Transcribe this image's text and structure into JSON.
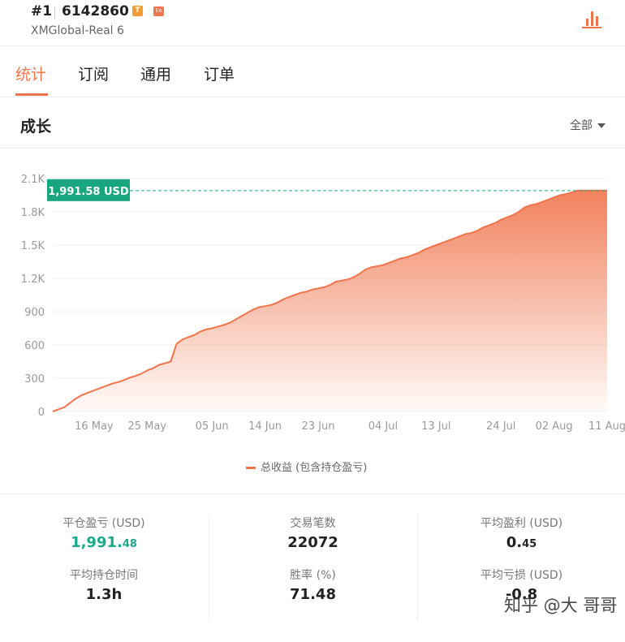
{
  "header": {
    "rank": "#1",
    "account": "6142860",
    "badge_t": "T",
    "badge_ea": "EA",
    "server": "XMGlobal-Real 6"
  },
  "tabs": [
    {
      "label": "统计",
      "active": true
    },
    {
      "label": "订阅",
      "active": false
    },
    {
      "label": "通用",
      "active": false
    },
    {
      "label": "订单",
      "active": false
    }
  ],
  "section": {
    "title": "成长",
    "range": "全部"
  },
  "chart_data": {
    "type": "area",
    "y_ticks": [
      "0",
      "300",
      "600",
      "900",
      "1.2K",
      "1.5K",
      "1.8K",
      "2.1K"
    ],
    "ylim": [
      0,
      2100
    ],
    "x_ticks": [
      "16 May",
      "25 May",
      "05 Jun",
      "14 Jun",
      "23 Jun",
      "04 Jul",
      "13 Jul",
      "24 Jul",
      "02 Aug",
      "11 Aug"
    ],
    "current_label": "1,991.58 USD",
    "current_value": 1991.58,
    "series": [
      {
        "name": "总收益 (包含持仓盈亏)",
        "color": "#f0744b",
        "x": [
          "09 May",
          "10 May",
          "11 May",
          "12 May",
          "13 May",
          "14 May",
          "15 May",
          "16 May",
          "17 May",
          "18 May",
          "19 May",
          "20 May",
          "21 May",
          "22 May",
          "23 May",
          "24 May",
          "25 May",
          "26 May",
          "27 May",
          "28 May",
          "29 May",
          "30 May",
          "31 May",
          "01 Jun",
          "02 Jun",
          "03 Jun",
          "04 Jun",
          "05 Jun",
          "06 Jun",
          "07 Jun",
          "08 Jun",
          "09 Jun",
          "10 Jun",
          "11 Jun",
          "12 Jun",
          "13 Jun",
          "14 Jun",
          "15 Jun",
          "16 Jun",
          "17 Jun",
          "18 Jun",
          "19 Jun",
          "20 Jun",
          "21 Jun",
          "22 Jun",
          "23 Jun",
          "24 Jun",
          "25 Jun",
          "26 Jun",
          "27 Jun",
          "28 Jun",
          "29 Jun",
          "30 Jun",
          "01 Jul",
          "02 Jul",
          "03 Jul",
          "04 Jul",
          "05 Jul",
          "06 Jul",
          "07 Jul",
          "08 Jul",
          "09 Jul",
          "10 Jul",
          "11 Jul",
          "12 Jul",
          "13 Jul",
          "14 Jul",
          "15 Jul",
          "16 Jul",
          "17 Jul",
          "18 Jul",
          "19 Jul",
          "20 Jul",
          "21 Jul",
          "22 Jul",
          "23 Jul",
          "24 Jul",
          "25 Jul",
          "26 Jul",
          "27 Jul",
          "28 Jul",
          "29 Jul",
          "30 Jul",
          "31 Jul",
          "01 Aug",
          "02 Aug",
          "03 Aug",
          "04 Aug",
          "05 Aug",
          "06 Aug",
          "07 Aug",
          "08 Aug",
          "09 Aug",
          "10 Aug",
          "11 Aug"
        ],
        "values": [
          0,
          20,
          40,
          80,
          120,
          150,
          170,
          190,
          210,
          230,
          250,
          265,
          280,
          305,
          320,
          340,
          370,
          390,
          420,
          435,
          450,
          610,
          650,
          670,
          690,
          720,
          740,
          750,
          765,
          780,
          800,
          830,
          860,
          890,
          920,
          940,
          950,
          960,
          980,
          1010,
          1030,
          1050,
          1070,
          1080,
          1100,
          1110,
          1120,
          1140,
          1170,
          1180,
          1190,
          1210,
          1240,
          1280,
          1300,
          1310,
          1320,
          1340,
          1360,
          1380,
          1390,
          1410,
          1430,
          1460,
          1480,
          1500,
          1520,
          1540,
          1560,
          1580,
          1600,
          1610,
          1630,
          1660,
          1680,
          1700,
          1730,
          1750,
          1770,
          1800,
          1840,
          1860,
          1870,
          1890,
          1910,
          1930,
          1950,
          1960,
          1975,
          1991.58,
          1991.58,
          1991.58,
          1991.58,
          1991.58,
          1991.58
        ]
      }
    ],
    "grid": true
  },
  "stats": {
    "closed_pl_label": "平仓盈亏 (USD)",
    "closed_pl_main": "1,991.",
    "closed_pl_cents": "48",
    "trades_label": "交易笔数",
    "trades_value": "22072",
    "avg_profit_label": "平均盈利 (USD)",
    "avg_profit_main": "0.",
    "avg_profit_cents": "45",
    "avg_hold_label": "平均持仓时间",
    "avg_hold_value": "1.3h",
    "winrate_label": "胜率 (%)",
    "winrate_value": "71.48",
    "avg_loss_label": "平均亏损 (USD)",
    "avg_loss_value": "-0.8"
  },
  "watermark": "知乎 @大 哥哥",
  "colors": {
    "accent": "#f0744b",
    "green": "#1aaa8a",
    "tag_bg": "#19a67f"
  }
}
